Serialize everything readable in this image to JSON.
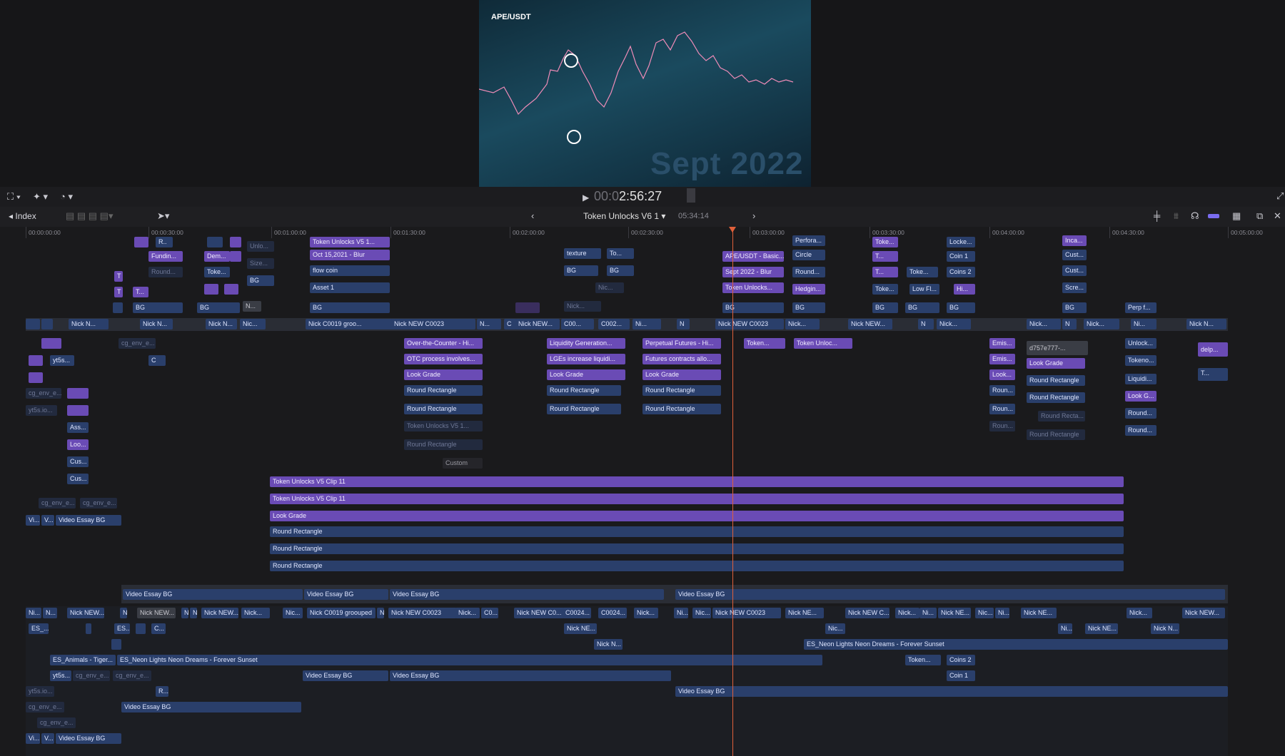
{
  "viewer": {
    "pair": "APE/USDT",
    "watermark": "Sept 2022",
    "timecode_dim": "00:0",
    "timecode": "2:56:27"
  },
  "header": {
    "index_label": "Index",
    "project_title": "Token Unlocks V6 1",
    "duration": "05:34:14"
  },
  "ruler": [
    "00:00:00:00",
    "00:00:30:00",
    "00:01:00:00",
    "00:01:30:00",
    "00:02:00:00",
    "00:02:30:00",
    "00:03:00:00",
    "00:03:30:00",
    "00:04:00:00",
    "00:04:30:00",
    "00:05:00:00"
  ],
  "clips": {
    "c1": "R..",
    "c2": "Fundin...",
    "c3": "Round...",
    "c4": "Dem...",
    "c5": "Toke...",
    "c6": "Unlo...",
    "c7": "Size...",
    "c8": "BG",
    "c9": "Token Unlocks V5 1...",
    "c10": "Oct 15,2021 - Blur",
    "c11": "flow coin",
    "c12": "Asset 1",
    "c13": "BG",
    "c14": "texture",
    "c15": "To...",
    "c16": "BG",
    "c17": "BG",
    "c18": "Nic...",
    "c19": "Nick...",
    "c20": "APE/USDT - Basic...",
    "c21": "Sept 2022 - Blur",
    "c22": "Token Unlocks...",
    "c23": "BG",
    "c24": "Perfora...",
    "c25": "Circle",
    "c26": "Round...",
    "c27": "Hedgin...",
    "c28": "BG",
    "c29": "Toke...",
    "c30": "T...",
    "c31": "T...",
    "c32": "Toke...",
    "c33": "Toke...",
    "c34": "Low Fl...",
    "c35": "BG",
    "c36": "BG",
    "c37": "Locke...",
    "c38": "Coin 1",
    "c39": "Coins 2",
    "c40": "Hi...",
    "c41": "BG",
    "c42": "Inca...",
    "c43": "Cust...",
    "c44": "Cust...",
    "c45": "Scre...",
    "c46": "BG",
    "c47": "Perp f...",
    "c48": "T",
    "c49": "T",
    "c50": "T...",
    "c51": "BG",
    "c52": "BG",
    "c53": "N...",
    "c54": "BG",
    "p1": "Nick N...",
    "p2": "Nick N...",
    "p3": "Nick N...",
    "p4": "Nic...",
    "p5": "Nick C0019 groo...",
    "p6": "Nick NEW C0023",
    "p7": "N...",
    "p8": "C",
    "p9": "Nick NEW...",
    "p10": "C00...",
    "p11": "C002...",
    "p12": "Ni...",
    "p13": "N",
    "p14": "Nick NEW C0023",
    "p15": "Nick...",
    "p16": "Nick NEW...",
    "p17": "N",
    "p18": "Nick...",
    "p19": "Nick...",
    "p20": "N",
    "p21": "Nick...",
    "p22": "Ni...",
    "p23": "Nick N...",
    "d1": "cg_env_e...",
    "d2": "C",
    "d3": "yt5s...",
    "d4": "cg_env_e...",
    "d5": "yt5s.io...",
    "d6": "Ass...",
    "d7": "Loo...",
    "d8": "Cus...",
    "d9": "Cus...",
    "d10": "cg_env_e...",
    "d11": "cg_env_e...",
    "d12": "Vi...",
    "d13": "V...",
    "d14": "Video Essay BG",
    "e1": "Over-the-Counter - Hi...",
    "e2": "OTC process involves...",
    "e3": "Look Grade",
    "e4": "Round Rectangle",
    "e5": "Round Rectangle",
    "e6": "Token Unlocks V5 1...",
    "e7": "Round Rectangle",
    "e8": "Custom",
    "e9": "Liquidity Generation...",
    "e10": "LGEs increase liquidi...",
    "e11": "Look Grade",
    "e12": "Round Rectangle",
    "e13": "Round Rectangle",
    "e14": "Perpetual Futures - Hi...",
    "e15": "Futures contracts allo...",
    "e16": "Look Grade",
    "e17": "Round Rectangle",
    "e18": "Round Rectangle",
    "e19": "Token...",
    "e20": "Token Unloc...",
    "e21": "Emis...",
    "e22": "Emis...",
    "e23": "Look...",
    "e24": "Roun...",
    "e25": "Roun...",
    "e26": "Roun...",
    "e27": "d757e777-...",
    "e28": "Look Grade",
    "e29": "Round Rectangle",
    "e30": "Round Rectangle",
    "e31": "Round Recta...",
    "e32": "Round Rectangle",
    "e33": "Unlock...",
    "e34": "Tokeno...",
    "e35": "Liquidi...",
    "e36": "Look G...",
    "e37": "Round...",
    "e38": "Round...",
    "e39": "delp...",
    "e40": "T...",
    "l1": "Token Unlocks V5 Clip 11",
    "l2": "Token Unlocks V5 Clip 11",
    "l3": "Look Grade",
    "l4": "Round Rectangle",
    "l5": "Round Rectangle",
    "l6": "Round Rectangle",
    "v1": "Video Essay BG",
    "v2": "Video Essay BG",
    "v3": "Video Essay BG",
    "v4": "Video Essay BG",
    "a1": "Ni...",
    "a2": "N...",
    "a3": "Nick NEW...",
    "a4": "N",
    "a5": "Nick NEW...",
    "a6": "N",
    "a7": "N",
    "a8": "Nick NEW...",
    "a9": "Nick...",
    "a10": "Nic...",
    "a11": "Nick C0019 groouped",
    "a12": "N",
    "a13": "Nick NEW C0023",
    "a14": "Nick...",
    "a15": "C0...",
    "a16": "Nick NEW C0...",
    "a17": "C0024...",
    "a18": "C0024...",
    "a19": "Nick...",
    "a20": "Ni...",
    "a21": "Nic...",
    "a22": "Nick NEW C0023",
    "a23": "Nick NE...",
    "a24": "Nick NEW C...",
    "a25": "Nick...",
    "a26": "Ni...",
    "a27": "Nick NE...",
    "a28": "Nic...",
    "a29": "Ni...",
    "a30": "Nick NE...",
    "a31": "Nick...",
    "a32": "Nick NEW...",
    "b1": "ES_...",
    "b2": "ES...",
    "b3": "C...",
    "b4": "Nick NE...",
    "b5": "Nic...",
    "b6": "Ni...",
    "b7": "Nick NE...",
    "b8": "Nick N...",
    "b9": "Nick N...",
    "b10": "ES_Neon Lights Neon Dreams - Forever Sunset",
    "b11": "ES_Animals - Tiger...",
    "b12": "ES_Neon Lights Neon Dreams - Forever Sunset",
    "b13": "Token...",
    "b14": "Coins 2",
    "b15": "yt5s...",
    "b16": "cg_env_e...",
    "b17": "cg_env_e...",
    "b18": "Video Essay BG",
    "b19": "Video Essay BG",
    "b20": "Coin 1",
    "b21": "yt5s.io...",
    "b22": "R...",
    "b23": "Video Essay BG",
    "b24": "cg_env_e...",
    "b25": "Video Essay BG",
    "b26": "cg_env_e...",
    "b27": "Vi...",
    "b28": "V...",
    "b29": "Video Essay BG"
  },
  "colors": {
    "playhead": "#e0603a",
    "clip_blue": "#2a3f6b",
    "clip_purple": "#6a4bb5"
  }
}
